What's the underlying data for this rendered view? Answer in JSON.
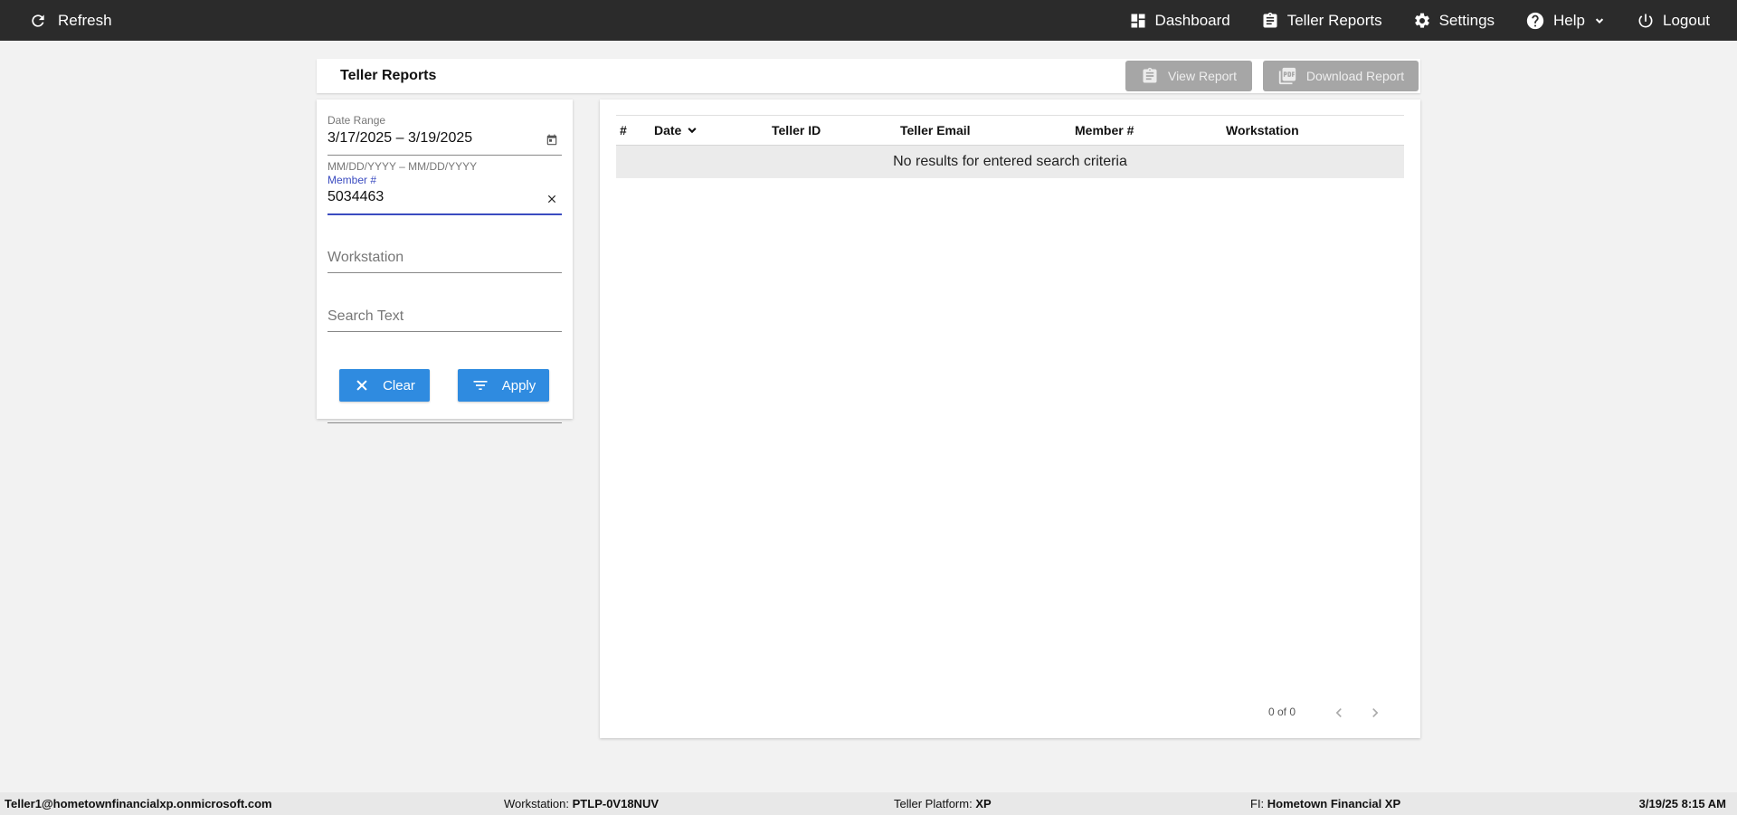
{
  "topbar": {
    "refresh_label": "Refresh",
    "nav": [
      {
        "label": "Dashboard",
        "icon": "dashboard-icon"
      },
      {
        "label": "Teller Reports",
        "icon": "clipboard-icon"
      },
      {
        "label": "Settings",
        "icon": "gear-icon"
      },
      {
        "label": "Help",
        "icon": "help-icon"
      },
      {
        "label": "Logout",
        "icon": "power-icon"
      }
    ]
  },
  "header": {
    "title": "Teller Reports",
    "view_report_label": "View Report",
    "download_report_label": "Download Report"
  },
  "filters": {
    "date_range": {
      "label": "Date Range",
      "value": "3/17/2025 – 3/19/2025",
      "hint": "MM/DD/YYYY – MM/DD/YYYY"
    },
    "member": {
      "label": "Member #",
      "value": "5034463"
    },
    "workstation": {
      "placeholder": "Workstation"
    },
    "search_text": {
      "placeholder": "Search Text"
    },
    "clear_label": "Clear",
    "apply_label": "Apply"
  },
  "table": {
    "columns": [
      "#",
      "Date",
      "Teller ID",
      "Teller Email",
      "Member #",
      "Workstation"
    ],
    "sort_column": "Date",
    "empty_message": "No results for entered search criteria",
    "pager_text": "0 of 0"
  },
  "footer": {
    "user": "Teller1@hometownfinancialxp.onmicrosoft.com",
    "workstation_label": "Workstation:",
    "workstation_value": "PTLP-0V18NUV",
    "platform_label": "Teller Platform:",
    "platform_value": "XP",
    "fi_label": "FI:",
    "fi_value": "Hometown Financial XP",
    "datetime": "3/19/25 8:15 AM"
  },
  "colors": {
    "topbar_bg": "#2b2b2b",
    "primary_button": "#2f8be0",
    "disabled_button": "#a6a6a6",
    "focus_accent": "#3b4cc0",
    "page_bg": "#f2f2f2"
  }
}
